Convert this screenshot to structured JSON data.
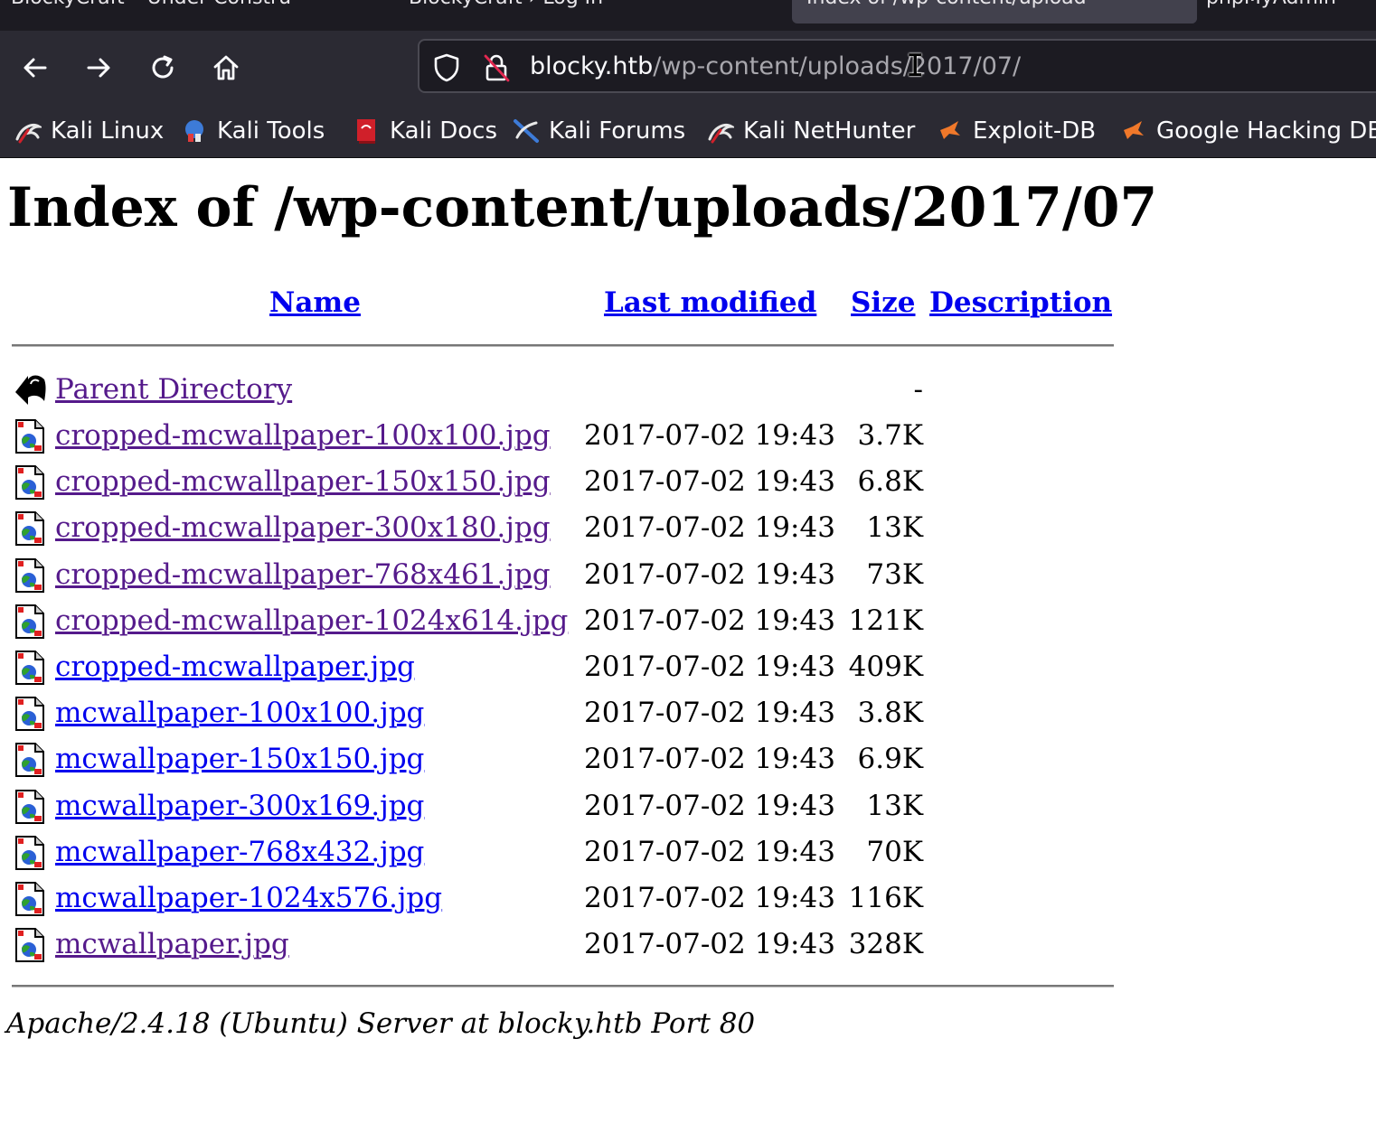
{
  "browser": {
    "tabs": [
      {
        "title": "BlockyCraft – Under Constru"
      },
      {
        "title": "BlockyCraft › Log In"
      },
      {
        "title": "Index of /wp-content/upload"
      },
      {
        "title": "phpMyAdmin"
      }
    ],
    "url": {
      "host": "blocky.htb",
      "path": "/wp-content/uploads/2017/07/"
    },
    "bookmarks": [
      {
        "label": "Kali Linux",
        "icon": "kali-dragon-icon"
      },
      {
        "label": "Kali Tools",
        "icon": "kali-tools-icon"
      },
      {
        "label": "Kali Docs",
        "icon": "kali-docs-icon"
      },
      {
        "label": "Kali Forums",
        "icon": "kali-forums-icon"
      },
      {
        "label": "Kali NetHunter",
        "icon": "kali-dragon-icon"
      },
      {
        "label": "Exploit-DB",
        "icon": "exploit-db-icon"
      },
      {
        "label": "Google Hacking DB",
        "icon": "exploit-db-icon"
      }
    ],
    "colors": {
      "tab_strip": "#1c1b22",
      "toolbar": "#2b2a33",
      "active_tab": "#42414d"
    }
  },
  "page": {
    "title": "Index of /wp-content/uploads/2017/07",
    "columns": {
      "name": "Name",
      "last_modified": "Last modified",
      "size": "Size",
      "description": "Description"
    },
    "parent": {
      "label": "Parent Directory",
      "size": "-",
      "icon": "back-arrow-icon"
    },
    "files": [
      {
        "name": "cropped-mcwallpaper-100x100.jpg",
        "modified": "2017-07-02 19:43",
        "size": "3.7K",
        "visited": true
      },
      {
        "name": "cropped-mcwallpaper-150x150.jpg",
        "modified": "2017-07-02 19:43",
        "size": "6.8K",
        "visited": true
      },
      {
        "name": "cropped-mcwallpaper-300x180.jpg",
        "modified": "2017-07-02 19:43",
        "size": "13K",
        "visited": true
      },
      {
        "name": "cropped-mcwallpaper-768x461.jpg",
        "modified": "2017-07-02 19:43",
        "size": "73K",
        "visited": true
      },
      {
        "name": "cropped-mcwallpaper-1024x614.jpg",
        "modified": "2017-07-02 19:43",
        "size": "121K",
        "visited": true
      },
      {
        "name": "cropped-mcwallpaper.jpg",
        "modified": "2017-07-02 19:43",
        "size": "409K",
        "visited": false
      },
      {
        "name": "mcwallpaper-100x100.jpg",
        "modified": "2017-07-02 19:43",
        "size": "3.8K",
        "visited": false
      },
      {
        "name": "mcwallpaper-150x150.jpg",
        "modified": "2017-07-02 19:43",
        "size": "6.9K",
        "visited": false
      },
      {
        "name": "mcwallpaper-300x169.jpg",
        "modified": "2017-07-02 19:43",
        "size": "13K",
        "visited": false
      },
      {
        "name": "mcwallpaper-768x432.jpg",
        "modified": "2017-07-02 19:43",
        "size": "70K",
        "visited": false
      },
      {
        "name": "mcwallpaper-1024x576.jpg",
        "modified": "2017-07-02 19:43",
        "size": "116K",
        "visited": false
      },
      {
        "name": "mcwallpaper.jpg",
        "modified": "2017-07-02 19:43",
        "size": "328K",
        "visited": true
      }
    ],
    "footer": "Apache/2.4.18 (Ubuntu) Server at blocky.htb Port 80",
    "colors": {
      "link": "#0000ee",
      "visited_link": "#551a8b"
    }
  }
}
